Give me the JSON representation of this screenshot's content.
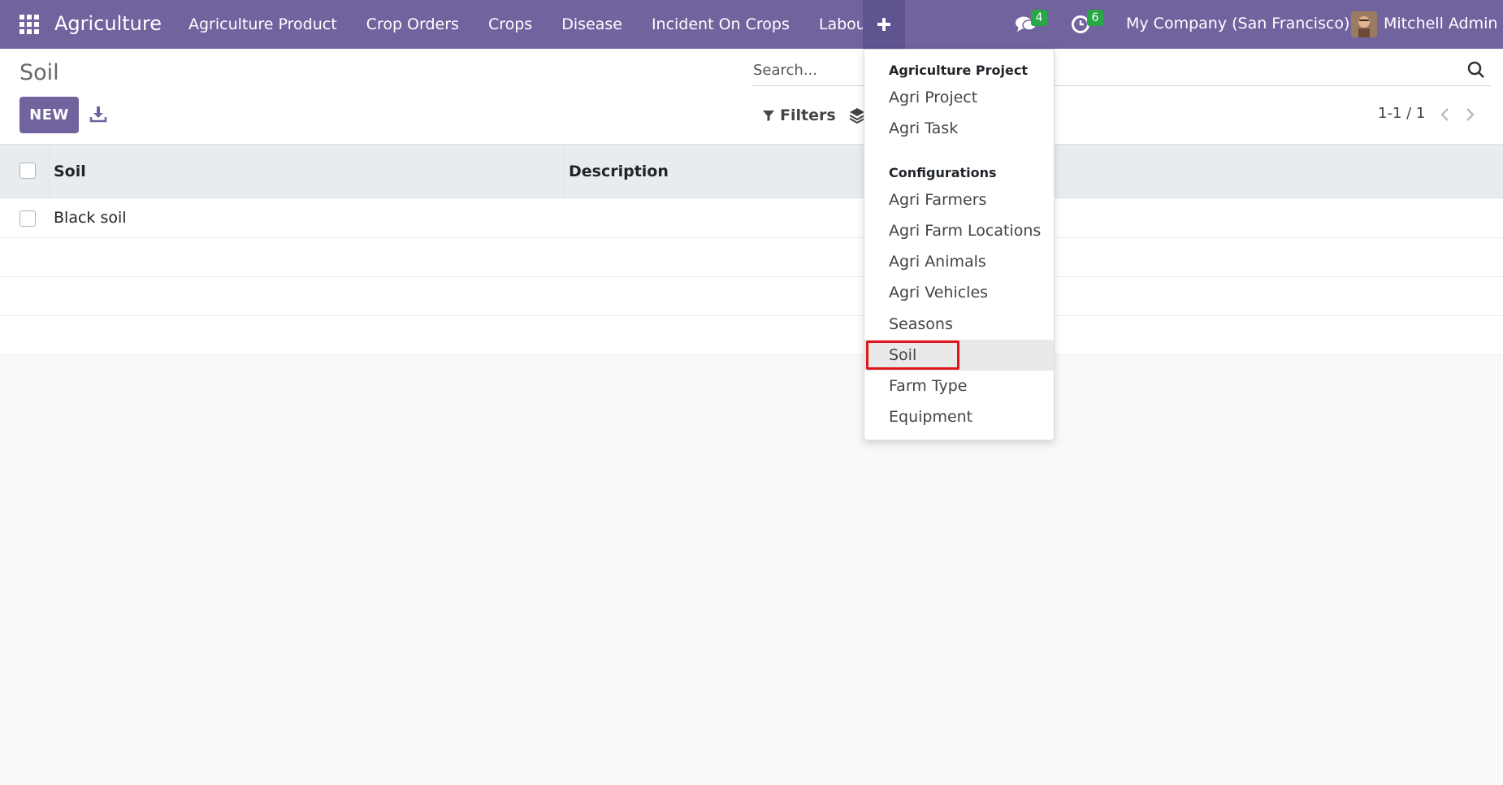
{
  "navbar": {
    "brand": "Agriculture",
    "menu": [
      {
        "label": "Agriculture Product"
      },
      {
        "label": "Crop Orders"
      },
      {
        "label": "Crops"
      },
      {
        "label": "Disease"
      },
      {
        "label": "Incident On Crops"
      },
      {
        "label": "Labours"
      }
    ],
    "messages_count": "4",
    "activities_count": "6",
    "company": "My Company (San Francisco)",
    "user": "Mitchell Admin",
    "colors": {
      "navbar": "#71639e",
      "badge": "#28a745"
    }
  },
  "control_panel": {
    "title": "Soil",
    "new_label": "NEW",
    "search_placeholder": "Search...",
    "filters_label": "Filters",
    "pager": "1-1 / 1"
  },
  "table": {
    "columns": [
      "Soil",
      "Description"
    ],
    "rows": [
      {
        "soil": "Black soil",
        "description": ""
      }
    ]
  },
  "dropdown": {
    "section_1": "Agriculture Project",
    "section_1_items": [
      "Agri Project",
      "Agri Task"
    ],
    "section_2": "Configurations",
    "section_2_items": [
      "Agri Farmers",
      "Agri Farm Locations",
      "Agri Animals",
      "Agri Vehicles",
      "Seasons",
      "Soil",
      "Farm Type",
      "Equipment"
    ],
    "active_item": "Soil",
    "highlight_color": "#e0161d"
  }
}
